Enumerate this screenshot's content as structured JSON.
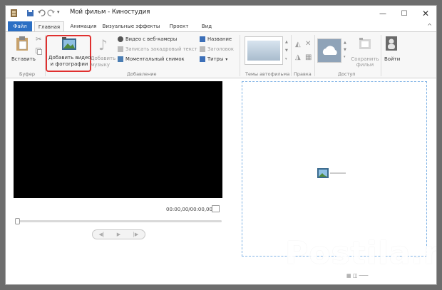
{
  "window": {
    "title": "Мой фильм - Киностудия",
    "qat_icons": [
      "app-icon",
      "save-icon",
      "undo-icon",
      "redo-icon",
      "customize-dropdown-icon"
    ]
  },
  "tabs": [
    {
      "label": "Файл"
    },
    {
      "label": "Главная"
    },
    {
      "label": "Анимация"
    },
    {
      "label": "Визуальные эффекты"
    },
    {
      "label": "Проект"
    },
    {
      "label": "Вид"
    }
  ],
  "ribbon": {
    "clipboard": {
      "paste": "Вставить",
      "group": "Буфер"
    },
    "add": {
      "add_video_line1": "Добавить видео",
      "add_video_line2": "и фотографии",
      "add_music_line1": "Добавить",
      "add_music_line2": "музыку",
      "webcam": "Видео с веб-камеры",
      "narration": "Записать закадровый текст",
      "snapshot": "Моментальный снимок",
      "title": "Название",
      "caption": "Заголовок",
      "credits": "Титры",
      "group": "Добавление"
    },
    "themes": {
      "group": "Темы автофильма"
    },
    "edit": {
      "group": "Правка"
    },
    "share": {
      "save_movie_line1": "Сохранить",
      "save_movie_line2": "фильм",
      "group": "Доступ"
    },
    "signin": {
      "label": "Войти"
    }
  },
  "player": {
    "time": "00:00,00/00:00,00",
    "progress": 0
  },
  "watermark": "Postila.ru",
  "colors": {
    "file_tab": "#2b6fc4",
    "highlight": "#e0302f",
    "storyboard_border": "#7fb2e5"
  }
}
